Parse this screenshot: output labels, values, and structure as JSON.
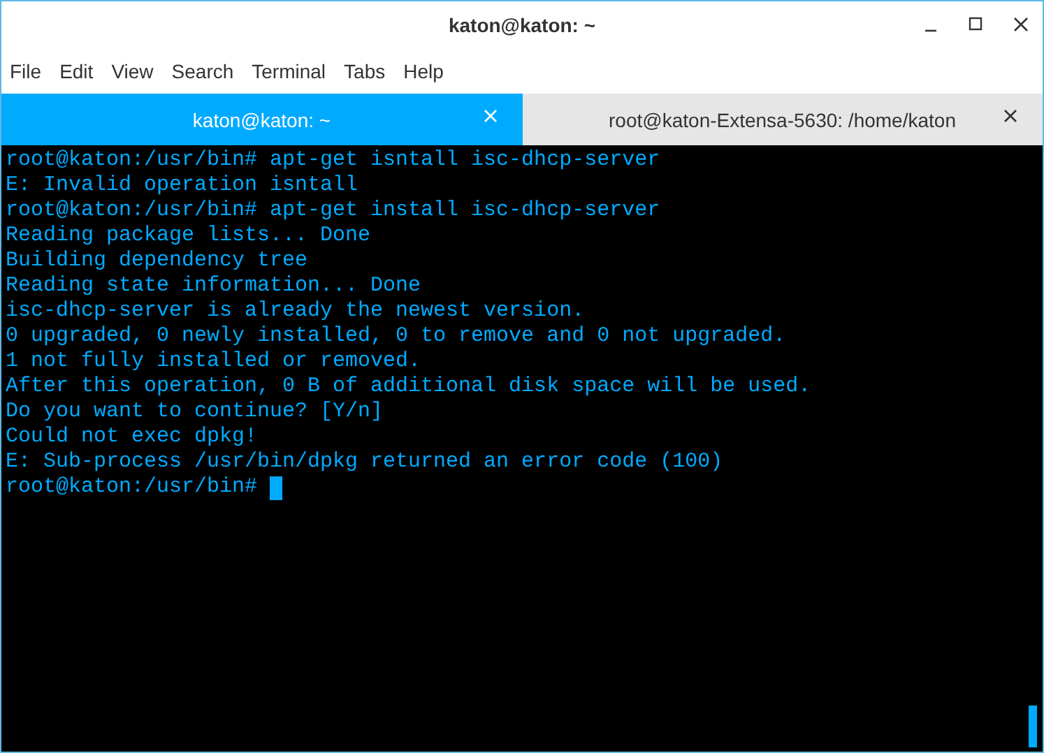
{
  "window": {
    "title": "katon@katon: ~"
  },
  "menu": [
    "File",
    "Edit",
    "View",
    "Search",
    "Terminal",
    "Tabs",
    "Help"
  ],
  "tabs": [
    {
      "label": "katon@katon: ~",
      "selected": true
    },
    {
      "label": "root@katon-Extensa-5630: /home/katon",
      "selected": false
    }
  ],
  "terminal": {
    "lines": [
      "root@katon:/usr/bin# apt-get isntall isc-dhcp-server",
      "E: Invalid operation isntall",
      "root@katon:/usr/bin# apt-get install isc-dhcp-server",
      "Reading package lists... Done",
      "Building dependency tree",
      "Reading state information... Done",
      "isc-dhcp-server is already the newest version.",
      "0 upgraded, 0 newly installed, 0 to remove and 0 not upgraded.",
      "1 not fully installed or removed.",
      "After this operation, 0 B of additional disk space will be used.",
      "Do you want to continue? [Y/n]",
      "Could not exec dpkg!",
      "E: Sub-process /usr/bin/dpkg returned an error code (100)"
    ],
    "prompt": "root@katon:/usr/bin#"
  }
}
